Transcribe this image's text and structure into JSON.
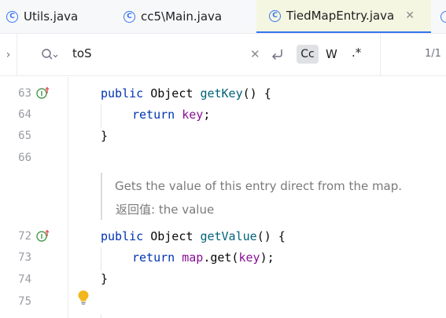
{
  "tabs": [
    {
      "icon": "C",
      "label": "Utils.java",
      "active": false,
      "closable": false
    },
    {
      "icon": "C",
      "label": "cc5\\Main.java",
      "active": false,
      "closable": false
    },
    {
      "icon": "C",
      "label": "TiedMapEntry.java",
      "active": true,
      "closable": true
    }
  ],
  "search": {
    "query": "toS",
    "match_case_label": "Cc",
    "words_label": "W",
    "regex_label": ".*",
    "match_count": "1/1"
  },
  "editor": {
    "lines": [
      {
        "number": "63",
        "implements_marker": true
      },
      {
        "number": "64",
        "implements_marker": false
      },
      {
        "number": "65",
        "implements_marker": false
      },
      {
        "number": "66",
        "implements_marker": false
      },
      {
        "number": "72",
        "implements_marker": true
      },
      {
        "number": "73",
        "implements_marker": false
      },
      {
        "number": "74",
        "implements_marker": false
      },
      {
        "number": "75",
        "implements_marker": false
      }
    ],
    "code": {
      "getkey_kw": "public",
      "getkey_type": "Object",
      "getkey_name": "getKey",
      "getkey_rest": "() {",
      "return_kw": "return",
      "key_field": "key",
      "semi": ";",
      "close_brace": "}",
      "getvalue_kw": "public",
      "getvalue_type": "Object",
      "getvalue_name": "getValue",
      "getvalue_rest": "() {",
      "map_field": "map",
      "get_call": ".get(",
      "get_arg": "key",
      "get_end": ");"
    },
    "doc": {
      "description": "Gets the value of this entry direct from the map.",
      "returns_label": "返回值:",
      "returns_text": "the value"
    }
  },
  "colors": {
    "accent": "#3574f0",
    "keyword": "#0033b3",
    "method": "#00627a",
    "field": "#871094",
    "active_tab_bg": "#f4f6e1"
  }
}
